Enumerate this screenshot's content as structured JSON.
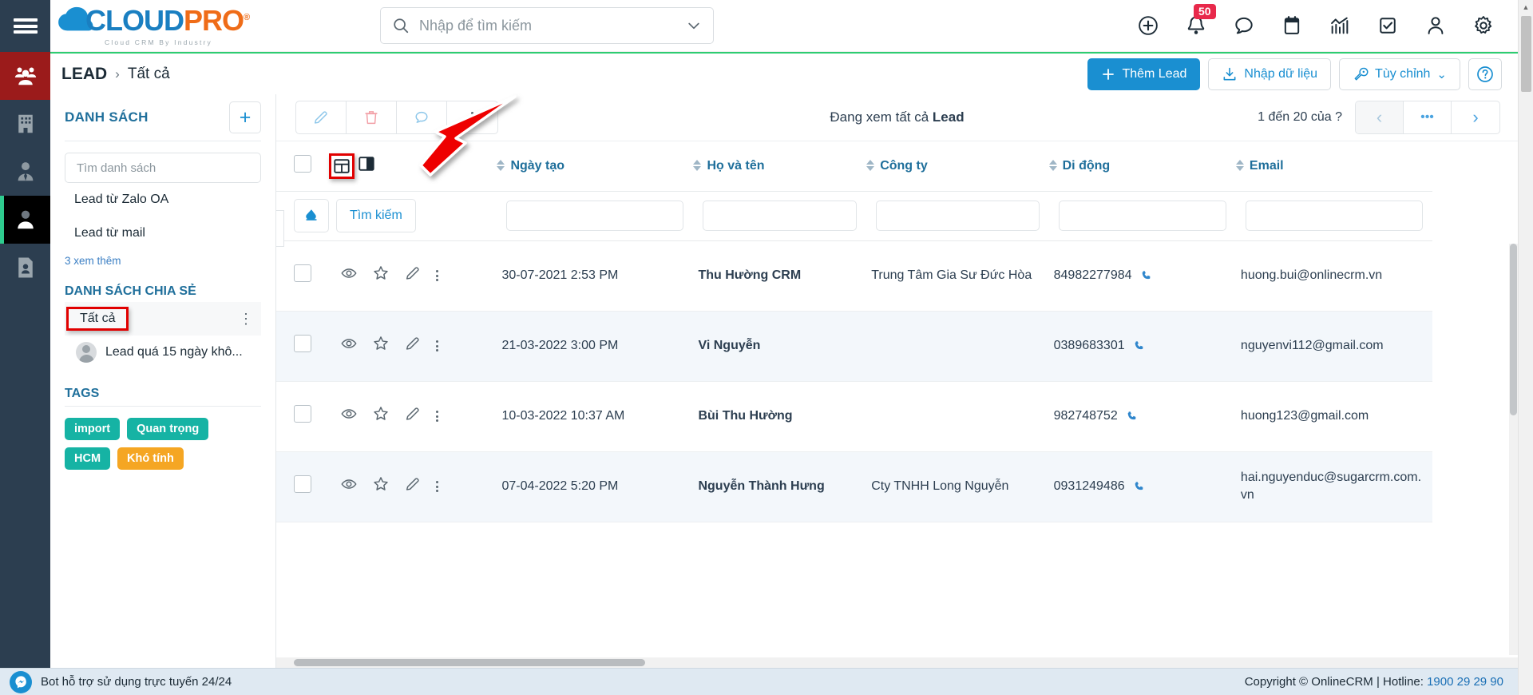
{
  "brand": {
    "name_part1": "CLOUD",
    "name_part2": "PRO",
    "registered": "®",
    "tagline": "Cloud CRM By Industry"
  },
  "header": {
    "search_placeholder": "Nhập để tìm kiếm",
    "search_value": "",
    "icons": [
      {
        "name": "add-circle-icon",
        "label": "Thêm"
      },
      {
        "name": "bell-icon",
        "label": "Thông báo",
        "badge": "50"
      },
      {
        "name": "chat-icon",
        "label": "Tin nhắn"
      },
      {
        "name": "calendar-icon",
        "label": "Lịch"
      },
      {
        "name": "chart-icon",
        "label": "Báo cáo"
      },
      {
        "name": "task-icon",
        "label": "Công việc"
      },
      {
        "name": "user-icon",
        "label": "Tài khoản"
      },
      {
        "name": "gear-icon",
        "label": "Cài đặt"
      }
    ],
    "notification_badge": "50"
  },
  "breadcrumb": {
    "root": "LEAD",
    "separator": "›",
    "current": "Tất cả",
    "actions": {
      "add_lead": "Thêm Lead",
      "import": "Nhập dữ liệu",
      "customize": "Tùy chỉnh",
      "customize_caret": "⌄",
      "help": "?"
    }
  },
  "sidebar_rail": [
    {
      "name": "hamburger-menu",
      "icon": "hamburger-icon"
    },
    {
      "name": "rail-item-leads-group",
      "icon": "people-group-icon",
      "active_red": true
    },
    {
      "name": "rail-item-company",
      "icon": "building-icon"
    },
    {
      "name": "rail-item-contact",
      "icon": "person-tie-icon"
    },
    {
      "name": "rail-item-lead",
      "icon": "person-icon",
      "active": true
    },
    {
      "name": "rail-item-document",
      "icon": "id-card-icon"
    }
  ],
  "listpanel": {
    "title": "DANH SÁCH",
    "add_button": "+",
    "search_placeholder": "Tìm danh sách",
    "search_value": "",
    "items": [
      {
        "label": "Lead từ Zalo OA"
      },
      {
        "label": "Lead từ mail"
      }
    ],
    "view_more": "3 xem thêm",
    "shared_title": "DANH SÁCH CHIA SẺ",
    "shared_selected": "Tất cả",
    "shared_items": [
      {
        "label": "Lead quá 15 ngày khô...",
        "has_avatar": true
      }
    ],
    "tags_title": "TAGS",
    "tags": [
      {
        "label": "import",
        "color": "#16b3a4"
      },
      {
        "label": "Quan trọng",
        "color": "#16b3a4"
      },
      {
        "label": "HCM",
        "color": "#16b3a4"
      },
      {
        "label": "Khó tính",
        "color": "#f5a623"
      }
    ]
  },
  "main": {
    "toolbar": [
      {
        "name": "edit-button",
        "icon": "pencil-icon"
      },
      {
        "name": "delete-button",
        "icon": "trash-icon"
      },
      {
        "name": "comment-button",
        "icon": "chat-bubble-icon"
      },
      {
        "name": "more-button",
        "icon": "vertical-dots-icon"
      }
    ],
    "viewing_prefix": "Đang xem tất cả ",
    "viewing_entity": "Lead",
    "pagination": {
      "range_text": "1 đến 20 của ",
      "total": "?",
      "prev": "‹",
      "more": "•••",
      "next": "›"
    },
    "collapse_handle": "‹",
    "view_toggle": [
      {
        "name": "grid-view-icon",
        "selected": true
      },
      {
        "name": "split-view-icon",
        "selected": false
      }
    ],
    "filter_row": {
      "erase": "erase-icon",
      "search_label": "Tìm kiếm"
    },
    "columns": [
      {
        "key": "checkbox",
        "label": ""
      },
      {
        "key": "tools",
        "label": ""
      },
      {
        "key": "created",
        "label": "Ngày tạo",
        "sortable": true
      },
      {
        "key": "fullname",
        "label": "Họ và tên",
        "sortable": true
      },
      {
        "key": "company",
        "label": "Công ty",
        "sortable": true
      },
      {
        "key": "mobile",
        "label": "Di động",
        "sortable": true
      },
      {
        "key": "email",
        "label": "Email",
        "sortable": true
      }
    ],
    "rows": [
      {
        "created": "30-07-2021 2:53 PM",
        "fullname": "Thu Hường CRM",
        "company": "Trung Tâm Gia Sư Đức Hòa",
        "mobile": "84982277984",
        "email": "huong.bui@onlinecrm.vn"
      },
      {
        "created": "21-03-2022 3:00 PM",
        "fullname": "Vi Nguyễn",
        "company": "",
        "mobile": "0389683301",
        "email": "nguyenvi112@gmail.com"
      },
      {
        "created": "10-03-2022 10:37 AM",
        "fullname": "Bùi Thu Hường",
        "company": "",
        "mobile": "982748752",
        "email": "huong123@gmail.com"
      },
      {
        "created": "07-04-2022 5:20 PM",
        "fullname": "Nguyễn Thành Hưng",
        "company": "Cty TNHH Long Nguyễn",
        "mobile": "0931249486",
        "email": "hai.nguyenduc@sugarcrm.com.vn"
      }
    ]
  },
  "footer": {
    "support_text": "Bot hỗ trợ sử dụng trực tuyến 24/24",
    "copyright": "Copyright © OnlineCRM | Hotline: ",
    "hotline": "1900 29 29 90"
  },
  "colors": {
    "accent_blue": "#1a8fd1",
    "brand_orange": "#ef6c18",
    "green_bar": "#2ecc71",
    "badge_red": "#e8294b",
    "annotation_red": "#e10000",
    "tag_teal": "#16b3a4",
    "tag_orange": "#f5a623"
  }
}
